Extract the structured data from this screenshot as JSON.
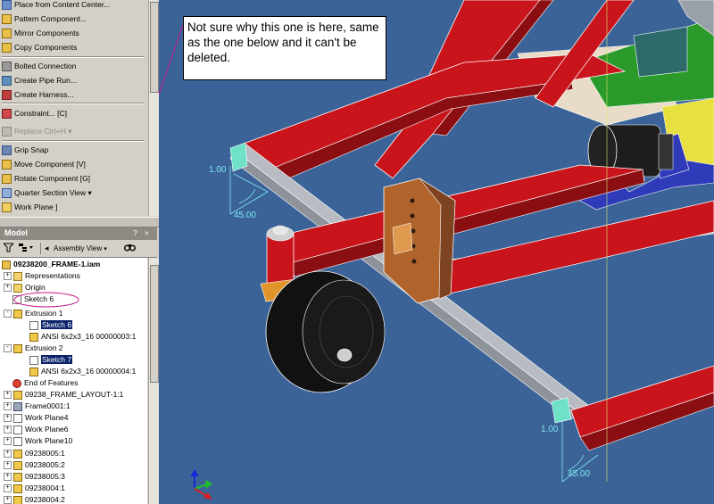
{
  "panel_menu": {
    "items": [
      {
        "label": "Place from Content Center...",
        "icon": "content-center-icon",
        "enabled": true
      },
      {
        "label": "Pattern Component...",
        "icon": "pattern-component-icon",
        "enabled": true
      },
      {
        "label": "Mirror Components",
        "icon": "mirror-components-icon",
        "enabled": true
      },
      {
        "label": "Copy Components",
        "icon": "copy-components-icon",
        "enabled": true
      },
      {
        "label": "Bolted Connection",
        "icon": "bolted-connection-icon",
        "enabled": true
      },
      {
        "label": "Create Pipe Run...",
        "icon": "pipe-run-icon",
        "enabled": true
      },
      {
        "label": "Create Harness...",
        "icon": "harness-icon",
        "enabled": true
      },
      {
        "label": "Constraint...  [C]",
        "icon": "constraint-icon",
        "enabled": true
      },
      {
        "label": "Replace  Ctrl+H  ▾",
        "icon": "replace-icon",
        "enabled": false
      },
      {
        "label": "Grip Snap",
        "icon": "grip-snap-icon",
        "enabled": true
      },
      {
        "label": "Move Component  [V]",
        "icon": "move-component-icon",
        "enabled": true
      },
      {
        "label": "Rotate Component  [G]",
        "icon": "rotate-component-icon",
        "enabled": true
      },
      {
        "label": "Quarter Section View  ▾",
        "icon": "section-view-icon",
        "enabled": true
      },
      {
        "label": "Work Plane  ]",
        "icon": "work-plane-icon",
        "enabled": true
      }
    ]
  },
  "browser": {
    "title": "Model",
    "assembly_view_label": "Assembly View",
    "tree": [
      {
        "label": "09238200_FRAME-1.iam",
        "level": 0,
        "expander": "",
        "selected": false,
        "bold": true
      },
      {
        "label": "Representations",
        "level": 0,
        "expander": "+",
        "selected": false
      },
      {
        "label": "Origin",
        "level": 0,
        "expander": "+",
        "selected": false
      },
      {
        "label": "Sketch 6",
        "level": 0,
        "expander": "",
        "selected": false
      },
      {
        "label": "Extrusion 1",
        "level": 0,
        "expander": "-",
        "selected": false
      },
      {
        "label": "Sketch 6",
        "level": 1,
        "expander": "",
        "selected": true
      },
      {
        "label": "ANSI 6x2x3_16 00000003:1",
        "level": 1,
        "expander": "",
        "selected": false
      },
      {
        "label": "Extrusion 2",
        "level": 0,
        "expander": "-",
        "selected": false
      },
      {
        "label": "Sketch 7",
        "level": 1,
        "expander": "",
        "selected": true
      },
      {
        "label": "ANSI 6x2x3_16 00000004:1",
        "level": 1,
        "expander": "",
        "selected": false
      },
      {
        "label": "End of Features",
        "level": 0,
        "expander": "",
        "selected": false
      },
      {
        "label": "09238_FRAME_LAYOUT-1:1",
        "level": 0,
        "expander": "+",
        "selected": false
      },
      {
        "label": "Frame0001:1",
        "level": 0,
        "expander": "+",
        "selected": false
      },
      {
        "label": "Work Plane4",
        "level": 0,
        "expander": "+",
        "selected": false
      },
      {
        "label": "Work Plane6",
        "level": 0,
        "expander": "+",
        "selected": false
      },
      {
        "label": "Work Plane10",
        "level": 0,
        "expander": "+",
        "selected": false
      },
      {
        "label": "09238005:1",
        "level": 0,
        "expander": "+",
        "selected": false
      },
      {
        "label": "09238005:2",
        "level": 0,
        "expander": "+",
        "selected": false
      },
      {
        "label": "09238005:3",
        "level": 0,
        "expander": "+",
        "selected": false
      },
      {
        "label": "09238004:1",
        "level": 0,
        "expander": "+",
        "selected": false
      },
      {
        "label": "09238004:2",
        "level": 0,
        "expander": "+",
        "selected": false
      }
    ]
  },
  "annotation": {
    "callout_text": "Not sure why this one is here, same as the one below and it can't be deleted."
  },
  "viewport": {
    "dimensions": [
      "1.00",
      "45.00",
      "1.00",
      "45.00"
    ],
    "colors": {
      "background": "#3b6398",
      "frame_red": "#c8141a",
      "dimension": "#7ee6ee",
      "annotation_line": "#c8168c"
    }
  }
}
